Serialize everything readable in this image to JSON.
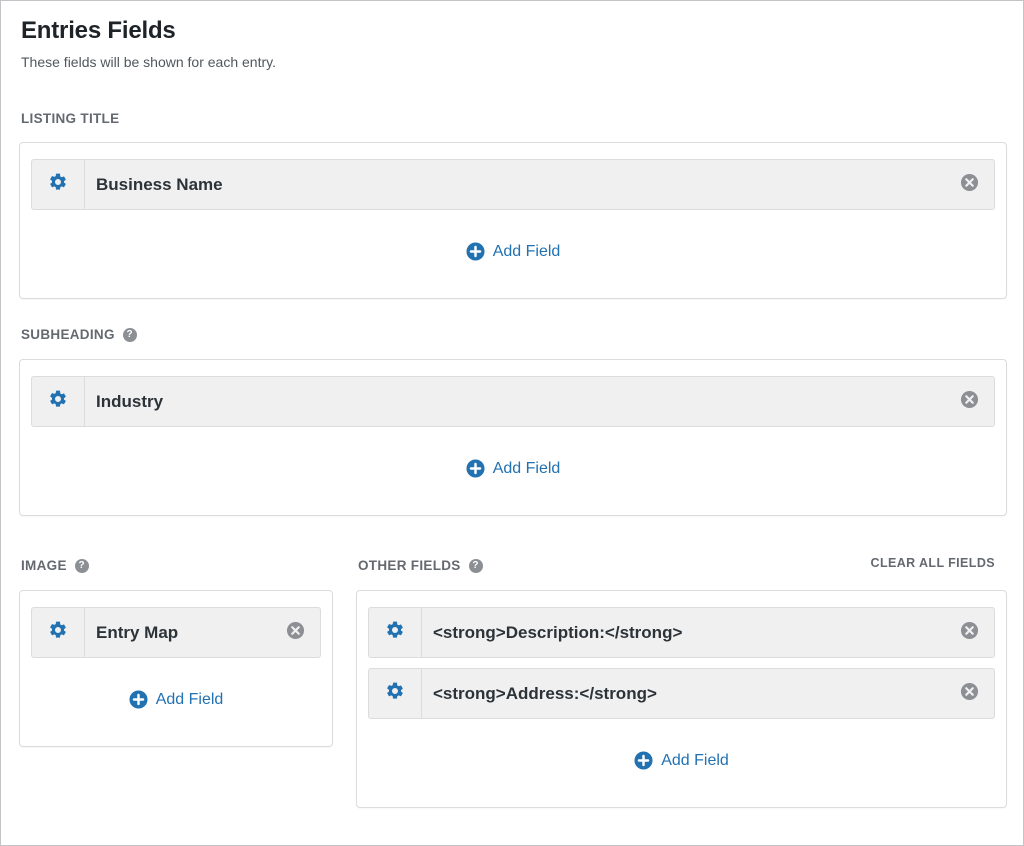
{
  "header": {
    "title": "Entries Fields",
    "description": "These fields will be shown for each entry."
  },
  "sections": {
    "listing_title": {
      "label": "LISTING TITLE",
      "fields": [
        "Business Name"
      ],
      "add_label": "Add Field"
    },
    "subheading": {
      "label": "SUBHEADING",
      "help": "?",
      "fields": [
        "Industry"
      ],
      "add_label": "Add Field"
    },
    "image": {
      "label": "IMAGE",
      "help": "?",
      "fields": [
        "Entry Map"
      ],
      "add_label": "Add Field"
    },
    "other_fields": {
      "label": "OTHER FIELDS",
      "help": "?",
      "clear_label": "CLEAR ALL FIELDS",
      "fields": [
        "<strong>Description:</strong>",
        "<strong>Address:</strong>"
      ],
      "add_label": "Add Field"
    }
  },
  "icons": {
    "gear": "gear-icon",
    "remove": "remove-circle-icon",
    "add": "plus-circle-icon",
    "help": "question-circle-icon"
  },
  "colors": {
    "accent": "#2271b1",
    "muted": "#646970",
    "field_bg": "#f0f0f1",
    "remove_icon": "#8c8f94"
  }
}
